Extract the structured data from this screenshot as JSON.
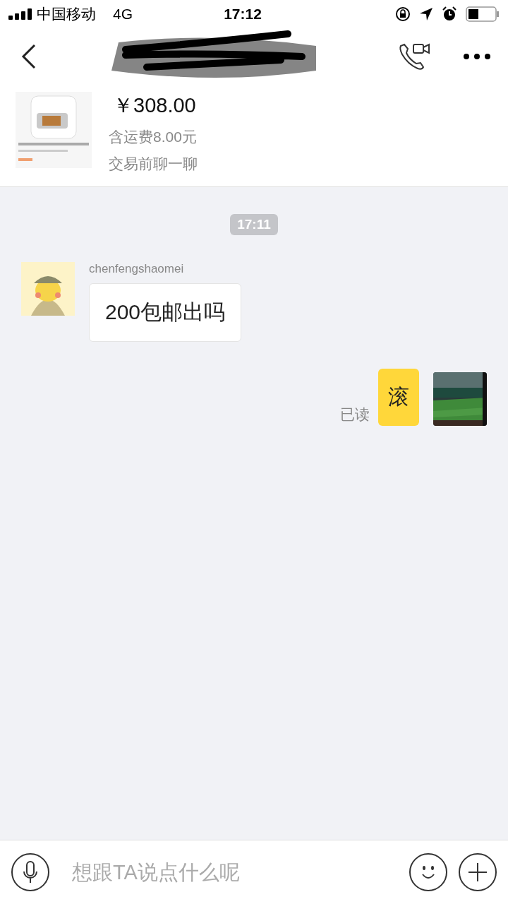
{
  "status_bar": {
    "carrier": "中国移动",
    "network": "4G",
    "time": "17:12"
  },
  "product": {
    "price": "￥308.00",
    "shipping": "含运费8.00元",
    "action": "交易前聊一聊"
  },
  "messages": [
    {
      "kind": "time",
      "text": "17:11"
    },
    {
      "kind": "received",
      "sender": "chenfengshaomei",
      "text": "200包邮出吗"
    },
    {
      "kind": "sent",
      "text": "滚",
      "receipt": "已读"
    }
  ],
  "composer": {
    "placeholder": "想跟TA说点什么呢"
  }
}
